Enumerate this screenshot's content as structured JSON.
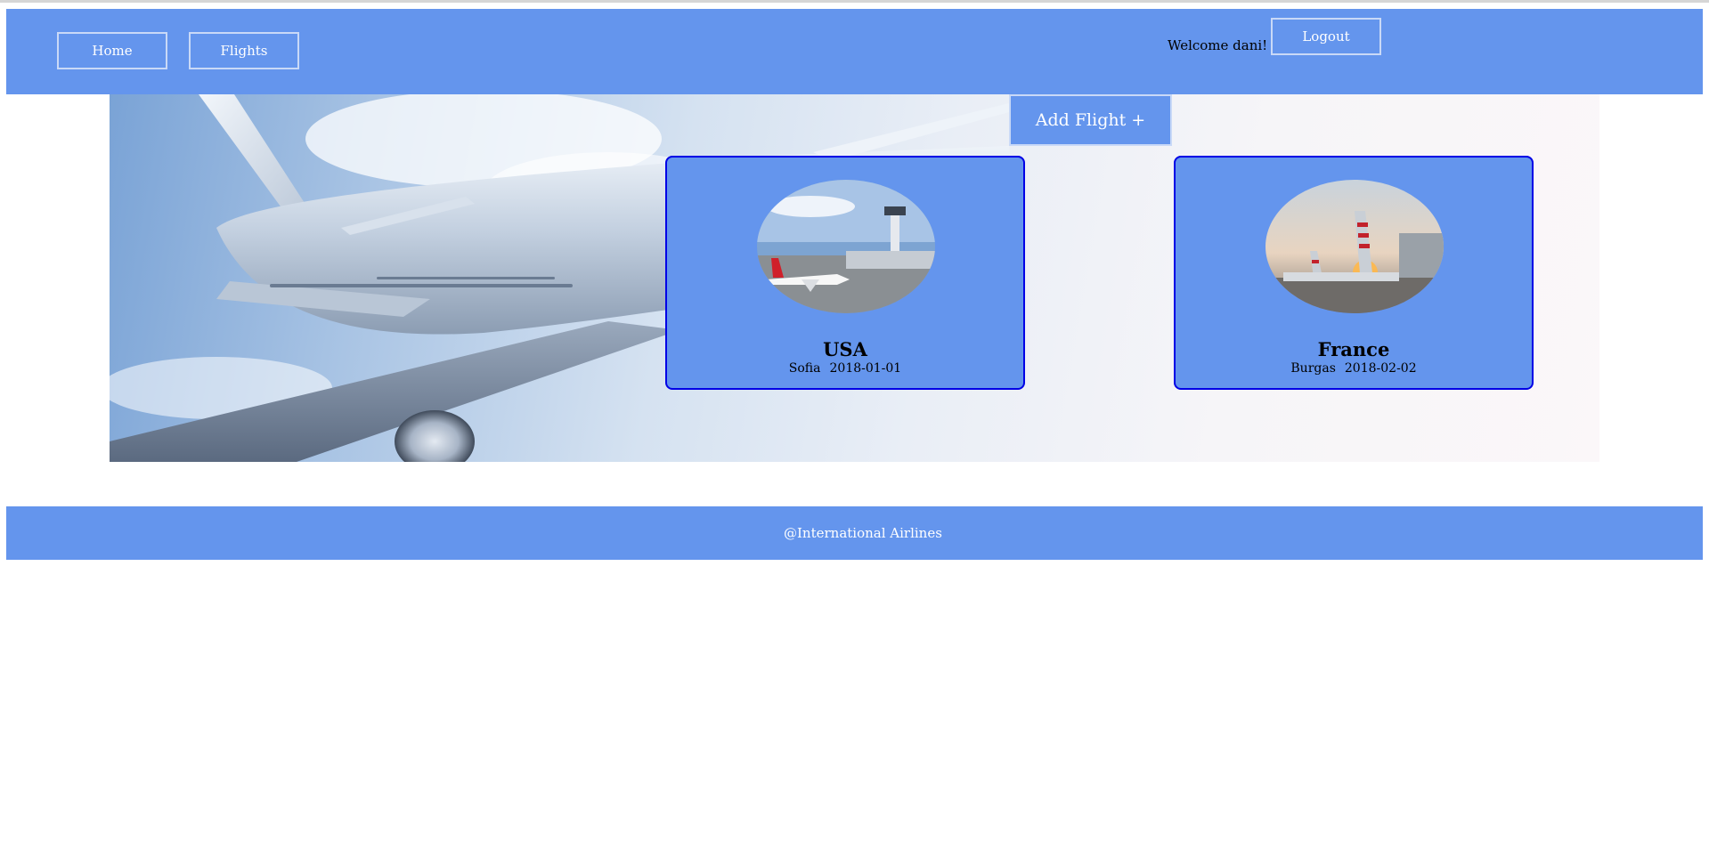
{
  "navbar": {
    "home_label": "Home",
    "flights_label": "Flights",
    "welcome_text": "Welcome dani!",
    "logout_label": "Logout"
  },
  "actions": {
    "add_flight_label": "Add Flight +"
  },
  "flights": [
    {
      "destination": "USA",
      "origin": "Sofia",
      "date": "2018-01-01"
    },
    {
      "destination": "France",
      "origin": "Burgas",
      "date": "2018-02-02"
    }
  ],
  "footer": {
    "text": "@International Airlines"
  },
  "colors": {
    "brand": "#6495ed",
    "card_border": "#0000e6",
    "button_border": "#c9d9f7"
  }
}
